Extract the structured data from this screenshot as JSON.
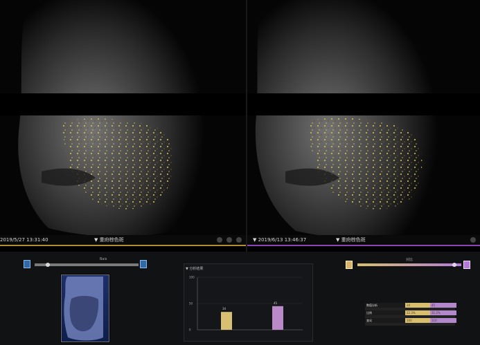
{
  "top": {
    "left_view": {
      "timestamp": "2019/5/27 13:31:40",
      "mode_label": "▼ 重府棕色斑"
    },
    "right_view": {
      "timestamp": "▼ 2019/6/13 13:46:37",
      "mode_label": "▼ 重府棕色斑"
    }
  },
  "bottom": {
    "left_control": {
      "label": "Bais"
    },
    "right_control": {
      "label": "对比"
    },
    "chart_header": "▼ 分析结果",
    "chart_data": {
      "type": "bar",
      "categories": [
        "",
        ""
      ],
      "values": [
        34,
        45
      ],
      "ylim": [
        0,
        100
      ],
      "yticks": [
        "100",
        "50",
        "0"
      ],
      "data_labels": [
        "34",
        "45"
      ],
      "colors": [
        "#d9bf72",
        "#b98ac7"
      ]
    },
    "table": {
      "rows": [
        [
          "数值分析",
          "34",
          "45"
        ],
        [
          "比例",
          "22.3%",
          "31.2%"
        ],
        [
          "变化",
          "100",
          "110"
        ]
      ]
    }
  },
  "colors": {
    "gold": "#d8bf6e",
    "purple": "#b37ad6",
    "frame": "#050505"
  }
}
